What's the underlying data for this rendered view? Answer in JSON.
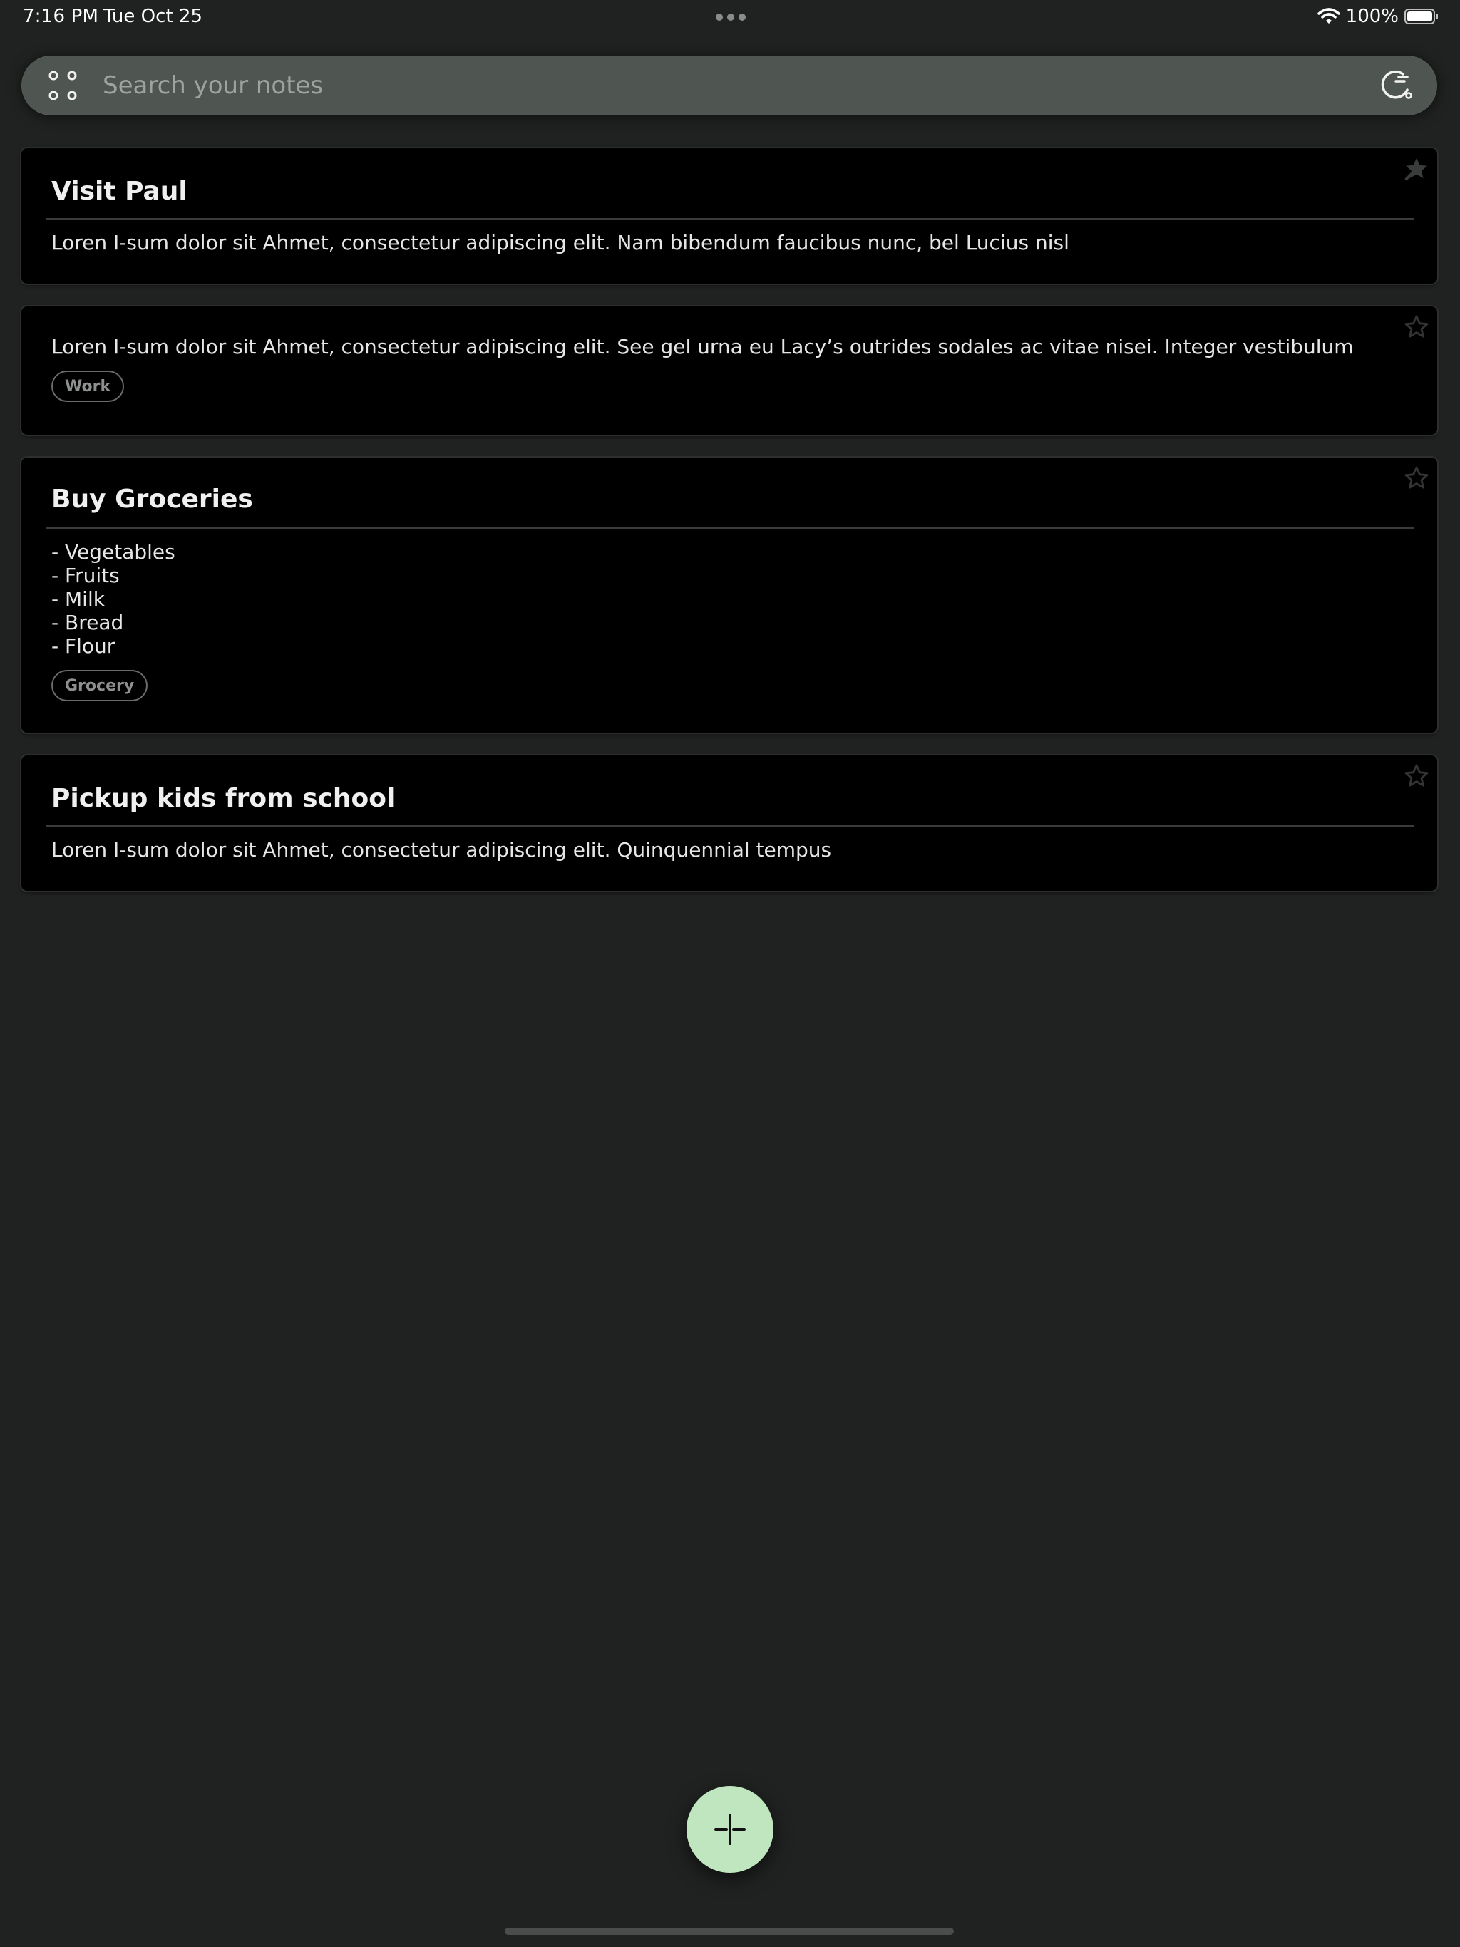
{
  "status_bar": {
    "time": "7:16 PM",
    "date": "Tue Oct 25",
    "battery_percent": "100%",
    "battery_level": 1.0,
    "wifi_icon": "wifi-icon",
    "battery_icon": "battery-icon"
  },
  "search": {
    "placeholder": "Search your notes",
    "value": "",
    "left_icon": "scan-icon",
    "right_icon": "sync-icon"
  },
  "notes": [
    {
      "title": "Visit Paul",
      "body": "Loren I-sum dolor sit Ahmet, consectetur adipiscing elit. Nam bibendum faucibus nunc, bel Lucius nisl",
      "tag": "",
      "pinned": true
    },
    {
      "title": "",
      "body": "Loren I-sum dolor sit Ahmet, consectetur adipiscing elit. See gel urna eu Lacy’s outrides sodales ac vitae nisei. Integer vestibulum",
      "tag": "Work",
      "pinned": false
    },
    {
      "title": "Buy Groceries",
      "body_lines": [
        "- Vegetables",
        "- Fruits",
        "- Milk",
        "- Bread",
        "- Flour"
      ],
      "tag": "Grocery",
      "pinned": false
    },
    {
      "title": "Pickup kids from school",
      "body": "Loren I-sum dolor sit Ahmet, consectetur adipiscing elit. Quinquennial tempus",
      "tag": "",
      "pinned": false
    }
  ],
  "fab": {
    "icon": "plus-icon"
  },
  "colors": {
    "background": "#202221",
    "card": "#000000",
    "search_bar": "#4f5651",
    "fab": "#bfe6bf"
  }
}
